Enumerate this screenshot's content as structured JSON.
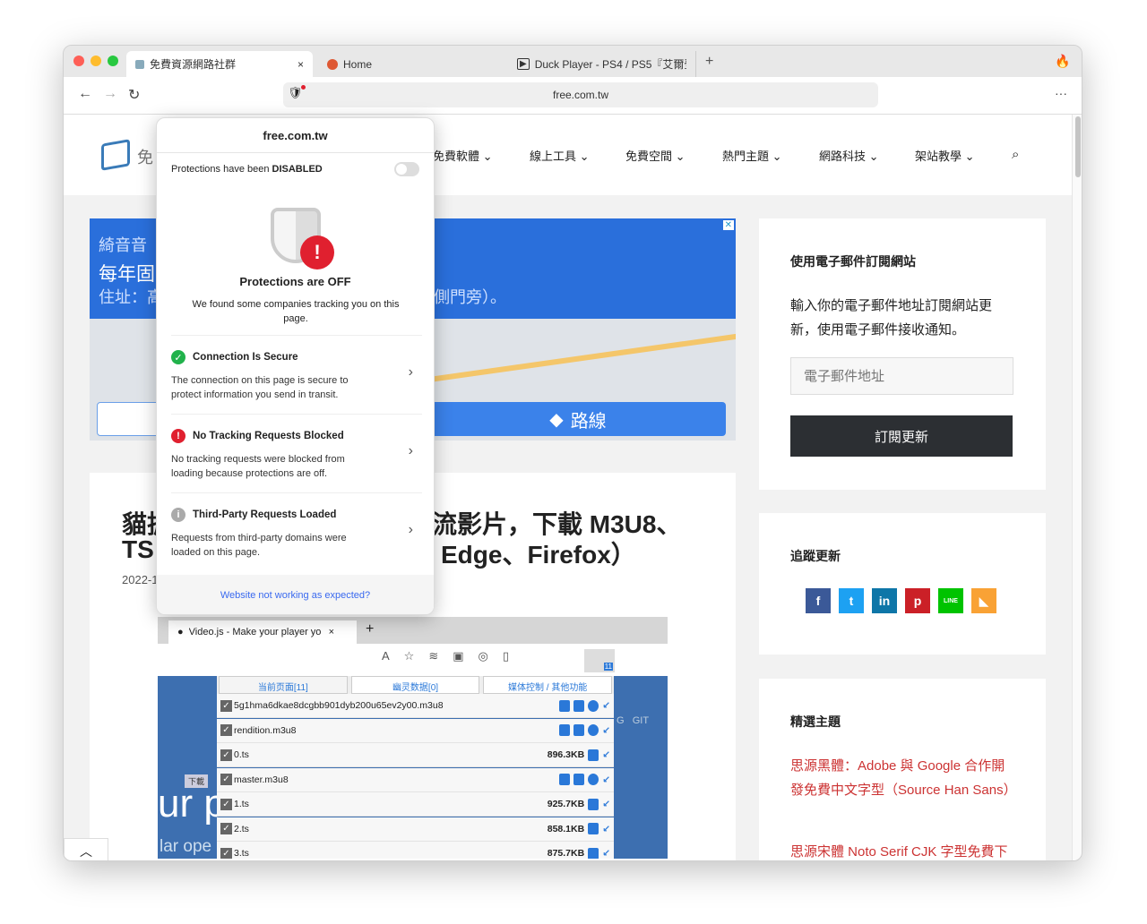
{
  "browser": {
    "tabs": [
      {
        "label": "免費資源網路社群",
        "active": true
      },
      {
        "label": "Home"
      },
      {
        "label": "Duck Player - PS4 / PS5『艾爾登"
      }
    ],
    "close_tab": "×",
    "new_tab": "+",
    "url": "free.com.tw",
    "more": "···"
  },
  "site": {
    "logo_text": "免",
    "nav": [
      "免費軟體",
      "線上工具",
      "免費空間",
      "熱門主題",
      "網路科技",
      "架站教學"
    ],
    "ad": {
      "line1": "綺音音",
      "line2": "每年固",
      "line3": "住址：高",
      "line3_right": "側門旁）。",
      "button": "路線"
    },
    "article": {
      "title_l1_left": "貓抓",
      "title_l1_right": "流影片，下載 M3U8、",
      "title_l2_left": "TS",
      "title_l2_right": "Edge、Firefox）",
      "date": "2022-1"
    },
    "subscribe": {
      "title": "使用電子郵件訂閱網站",
      "desc": "輸入你的電子郵件地址訂閱網站更新，使用電子郵件接收通知。",
      "placeholder": "電子郵件地址",
      "button": "訂閱更新"
    },
    "follow": {
      "title": "追蹤更新",
      "icons": [
        {
          "name": "facebook",
          "glyph": "f",
          "color": "#3b5998"
        },
        {
          "name": "twitter",
          "glyph": "t",
          "color": "#1da1f2"
        },
        {
          "name": "linkedin",
          "glyph": "in",
          "color": "#0e76a8"
        },
        {
          "name": "pinterest",
          "glyph": "p",
          "color": "#cb2027"
        },
        {
          "name": "line",
          "glyph": "LINE",
          "color": "#00c300"
        },
        {
          "name": "rss",
          "glyph": "◣",
          "color": "#f9a235"
        }
      ]
    },
    "featured": {
      "title": "精選主題",
      "links": [
        "思源黑體：Adobe 與 Google 合作開發免費中文字型（Source Han Sans）",
        "思源宋體 Noto Serif CJK 字型免費下"
      ]
    }
  },
  "popover": {
    "domain": "free.com.tw",
    "toggle_label_prefix": "Protections have been ",
    "toggle_label_state": "DISABLED",
    "protection_enabled": false,
    "status_title": "Protections are OFF",
    "status_desc": "We found some companies tracking you on this page.",
    "sections": [
      {
        "title": "Connection Is Secure",
        "desc": "The connection on this page is secure to protect information you send in transit.",
        "status": "ok"
      },
      {
        "title": "No Tracking Requests Blocked",
        "desc": "No tracking requests were blocked from loading because protections are off.",
        "status": "error"
      },
      {
        "title": "Third-Party Requests Loaded",
        "desc": "Requests from third-party domains were loaded on this page.",
        "status": "info"
      }
    ],
    "footer_link": "Website not working as expected?"
  },
  "embedded": {
    "tab": "Video.js - Make your player yo",
    "badge": "11",
    "download_tag": "下載",
    "bg_text1": "ur p",
    "bg_text2": "lar ope",
    "bg_nav": "G   GIT",
    "tabs": [
      "当前页面[11]",
      "幽灵数据[0]",
      "媒体控制 / 其他功能"
    ],
    "files": [
      {
        "name": "5g1hma6dkae8dcgbb901dyb200u65ev2y00.m3u8",
        "size": ""
      },
      {
        "name": "rendition.m3u8",
        "size": ""
      },
      {
        "name": "0.ts",
        "size": "896.3KB"
      },
      {
        "name": "master.m3u8",
        "size": ""
      },
      {
        "name": "1.ts",
        "size": "925.7KB"
      },
      {
        "name": "2.ts",
        "size": "858.1KB"
      },
      {
        "name": "3.ts",
        "size": "875.7KB"
      }
    ]
  },
  "colors": {
    "accent_red": "#e0202f",
    "secure_green": "#21b24b",
    "link_blue": "#3969ef",
    "ad_blue": "#2a6fdb",
    "featured_link": "#cc3333"
  }
}
